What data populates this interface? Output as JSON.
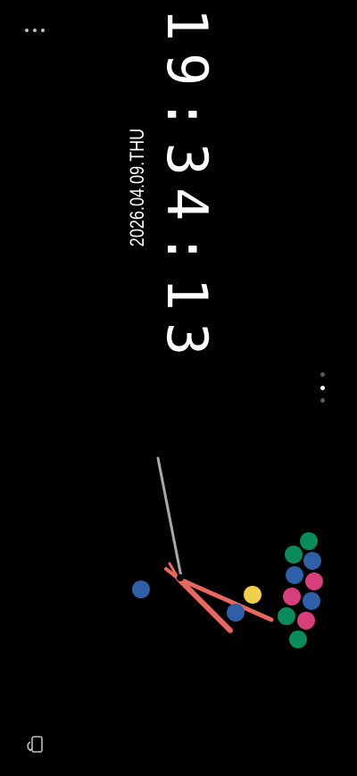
{
  "clock": {
    "time": "19:34:13",
    "date": "2026.04.09.THU"
  },
  "colors": {
    "background": "#000000",
    "text": "#ffffff",
    "hands": "#e8675f",
    "pole": "#a9a9a9",
    "ball_green": "#0b8a5a",
    "ball_blue": "#2f5fa7",
    "ball_pink": "#d63f7a",
    "ball_yellow": "#f2cf4a",
    "indicator_active": "#ffffff",
    "indicator_inactive": "#5a5a5a"
  },
  "icons": {
    "menu": "more-dots-icon",
    "rotate": "screen-rotate-icon"
  },
  "pager": {
    "pages": 3,
    "active_index": 1
  }
}
